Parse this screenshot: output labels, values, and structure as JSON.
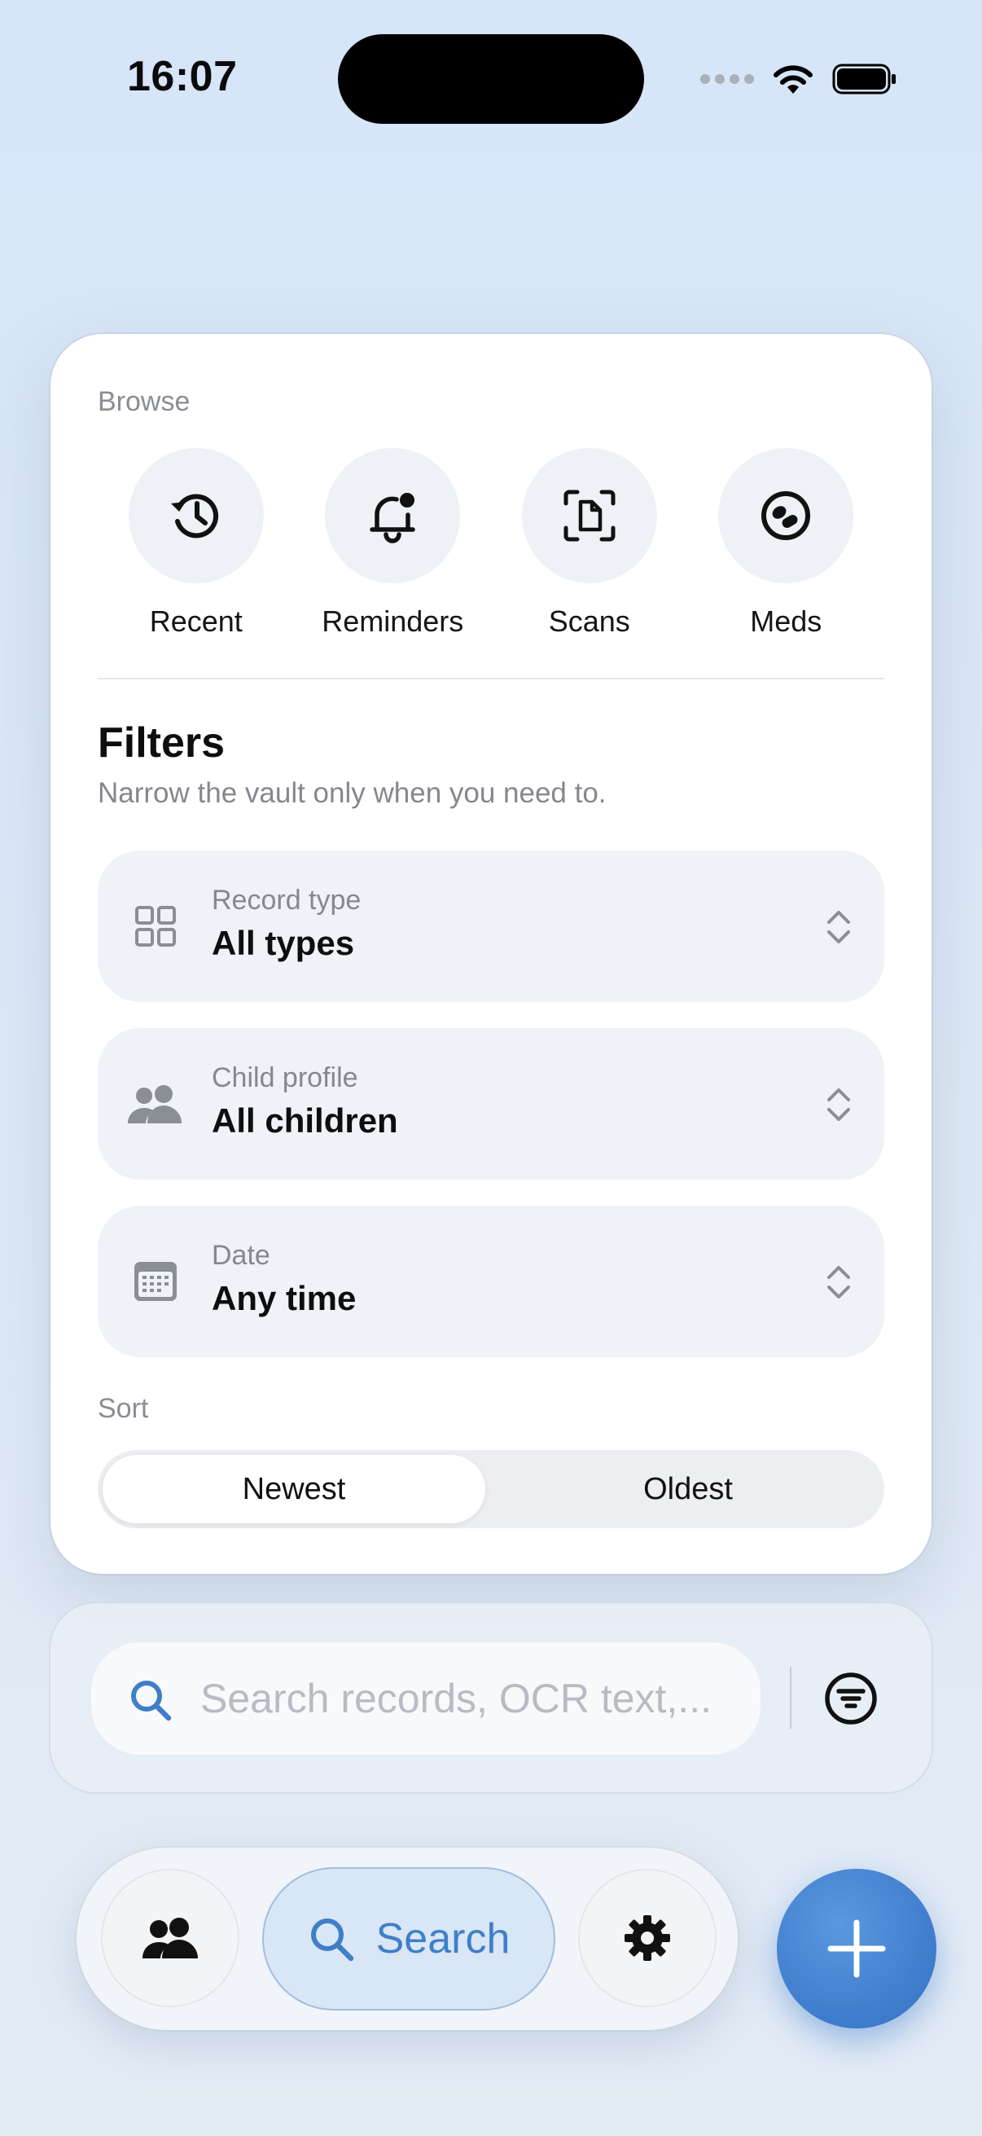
{
  "status_bar": {
    "time": "16:07"
  },
  "browse": {
    "label": "Browse",
    "items": [
      {
        "label": "Recent",
        "icon": "history-icon"
      },
      {
        "label": "Reminders",
        "icon": "bell-badge-icon"
      },
      {
        "label": "Scans",
        "icon": "document-scan-icon"
      },
      {
        "label": "Meds",
        "icon": "pill-icon"
      }
    ]
  },
  "filters": {
    "title": "Filters",
    "subtitle": "Narrow the vault only when you need to.",
    "rows": [
      {
        "caption": "Record type",
        "value": "All types",
        "icon": "grid-icon"
      },
      {
        "caption": "Child profile",
        "value": "All children",
        "icon": "people-icon"
      },
      {
        "caption": "Date",
        "value": "Any time",
        "icon": "calendar-icon"
      }
    ]
  },
  "sort": {
    "label": "Sort",
    "options": [
      "Newest",
      "Oldest"
    ],
    "selected": "Newest"
  },
  "search": {
    "placeholder": "Search records, OCR text,..."
  },
  "tabbar": {
    "search_label": "Search"
  },
  "colors": {
    "accent": "#3f7fc8",
    "fab": "#4a88d6",
    "card": "#ffffff"
  }
}
